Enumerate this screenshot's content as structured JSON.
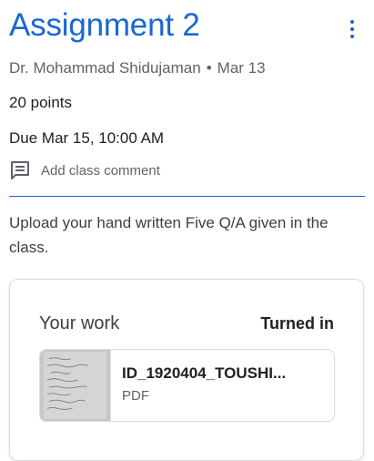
{
  "assignment": {
    "title": "Assignment 2",
    "teacher": "Dr. Mohammad Shidujaman",
    "separator": "•",
    "posted_date": "Mar 13",
    "points": "20 points",
    "due": "Due Mar 15, 10:00 AM",
    "comment_label": "Add class comment",
    "description": "Upload your hand written Five Q/A given in the class."
  },
  "your_work": {
    "title": "Your work",
    "status": "Turned in",
    "attachment": {
      "name": "ID_1920404_TOUSHI...",
      "type": "PDF"
    }
  },
  "icons": {
    "menu": "more-vert-icon",
    "comment": "comment-icon"
  },
  "colors": {
    "accent": "#1967d2",
    "secondary_text": "#5f6368",
    "primary_text": "#202124"
  }
}
